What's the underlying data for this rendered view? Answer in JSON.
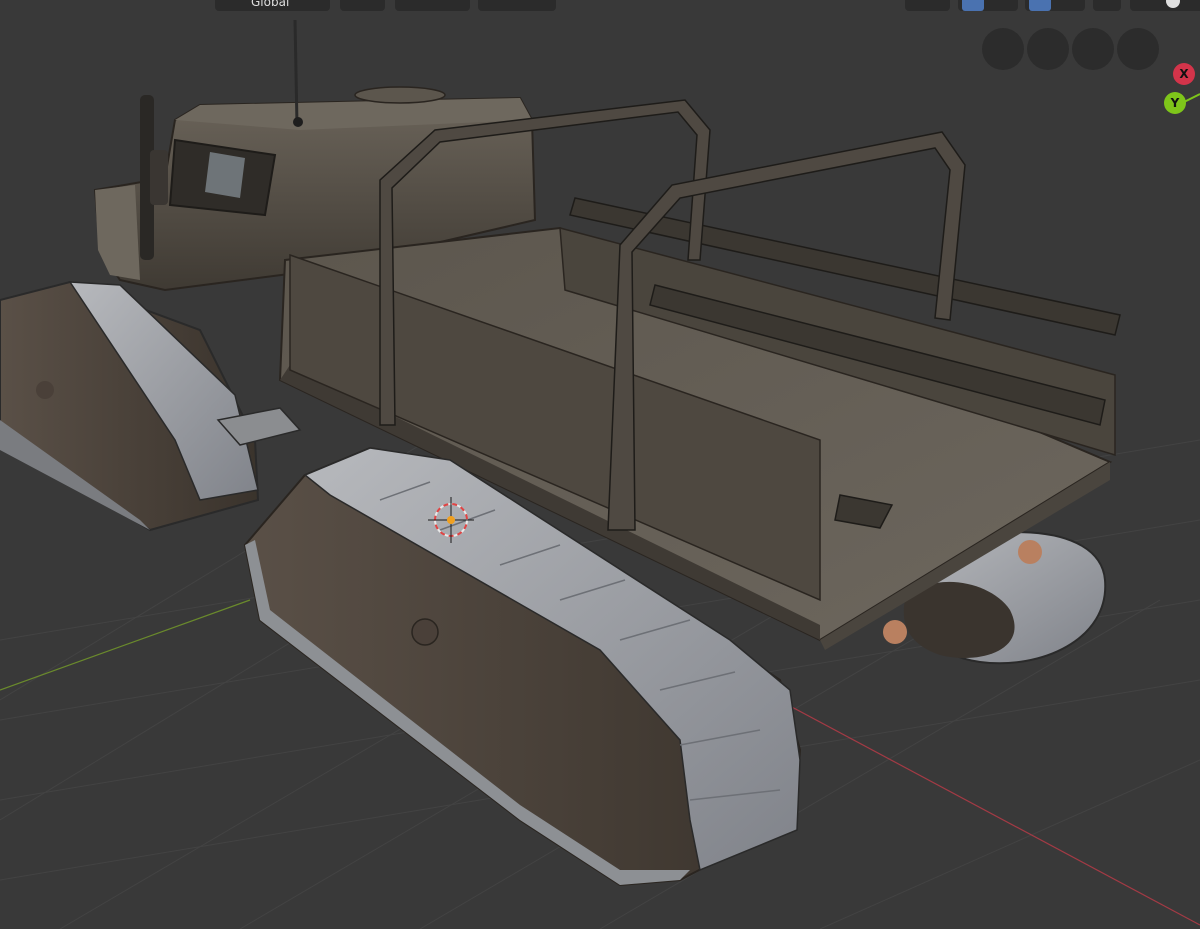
{
  "header": {
    "transform_orientation": "Global"
  },
  "gizmo": {
    "x_label": "X",
    "y_label": "Y",
    "nav_buttons": [
      "zoom-icon",
      "pan-icon",
      "camera-icon",
      "perspective-icon"
    ]
  },
  "colors": {
    "background": "#393939",
    "axis_x": "#d3344a",
    "axis_y": "#7ec51a",
    "cursor": "#f0a020",
    "track_metal": "#a4a6ab",
    "truck_body": "#4f4a43"
  }
}
